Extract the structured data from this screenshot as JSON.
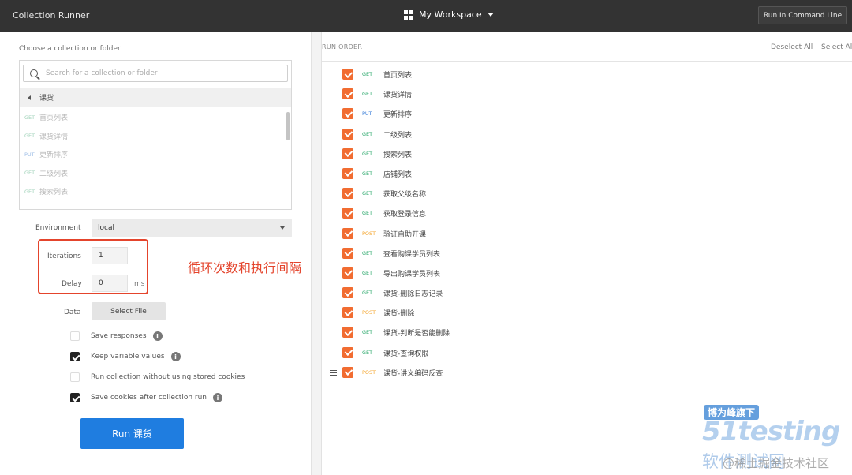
{
  "topbar": {
    "title": "Collection Runner",
    "workspace": "My Workspace",
    "command_line_button": "Run In Command Line"
  },
  "left": {
    "choose_label": "Choose a collection or folder",
    "search_placeholder": "Search for a collection or folder",
    "folder": "课货",
    "requests": [
      {
        "method": "GET",
        "name": "首页列表"
      },
      {
        "method": "GET",
        "name": "课货详情"
      },
      {
        "method": "PUT",
        "name": "更新排序"
      },
      {
        "method": "GET",
        "name": "二级列表"
      },
      {
        "method": "GET",
        "name": "搜索列表"
      }
    ],
    "environment_label": "Environment",
    "environment_value": "local",
    "iterations_label": "Iterations",
    "iterations_value": "1",
    "delay_label": "Delay",
    "delay_value": "0",
    "delay_unit": "ms",
    "data_label": "Data",
    "select_file": "Select File",
    "options": [
      {
        "label": "Save responses",
        "checked": false,
        "info": true
      },
      {
        "label": "Keep variable values",
        "checked": true,
        "info": true
      },
      {
        "label": "Run collection without using stored cookies",
        "checked": false,
        "info": false
      },
      {
        "label": "Save cookies after collection run",
        "checked": true,
        "info": true
      }
    ],
    "run_button": "Run 课货"
  },
  "annotation": "循环次数和执行间隔",
  "right": {
    "run_order_label": "RUN ORDER",
    "deselect_all": "Deselect All",
    "select_all": "Select All",
    "items": [
      {
        "method": "GET",
        "name": "首页列表"
      },
      {
        "method": "GET",
        "name": "课货详情"
      },
      {
        "method": "PUT",
        "name": "更新排序"
      },
      {
        "method": "GET",
        "name": "二级列表"
      },
      {
        "method": "GET",
        "name": "搜索列表"
      },
      {
        "method": "GET",
        "name": "店铺列表"
      },
      {
        "method": "GET",
        "name": "获取父级名称"
      },
      {
        "method": "GET",
        "name": "获取登录信息"
      },
      {
        "method": "POST",
        "name": "验证自助开课"
      },
      {
        "method": "GET",
        "name": "查看购课学员列表"
      },
      {
        "method": "GET",
        "name": "导出购课学员列表"
      },
      {
        "method": "GET",
        "name": "课货-删除日志记录"
      },
      {
        "method": "POST",
        "name": "课货-删除"
      },
      {
        "method": "GET",
        "name": "课货-判断是否能删除"
      },
      {
        "method": "GET",
        "name": "课货-查询权限"
      },
      {
        "method": "POST",
        "name": "课货-讲义编码反查"
      }
    ]
  },
  "watermark": {
    "tagline": "博为峰旗下",
    "brand": "51testing",
    "subtitle": "软件测试网",
    "credit": "@稀土掘金技术社区"
  },
  "colors": {
    "topbar": "#333333",
    "accent_orange": "#f16c31",
    "run_button": "#1f7de0",
    "annotation_red": "#e4442c",
    "get": "#2ba86b",
    "put": "#3c7fd8",
    "post": "#f4a52e"
  }
}
